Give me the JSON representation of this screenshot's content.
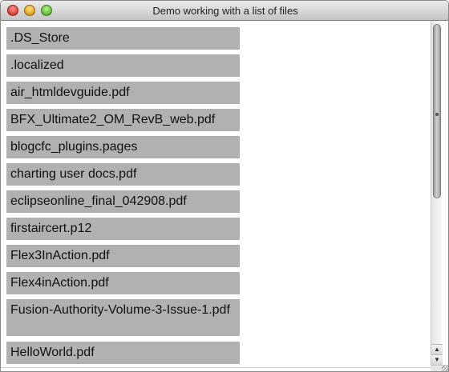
{
  "window": {
    "title": "Demo working with a list of files"
  },
  "files": [
    ".DS_Store",
    ".localized",
    "air_htmldevguide.pdf",
    "BFX_Ultimate2_OM_RevB_web.pdf",
    "blogcfc_plugins.pages",
    "charting user docs.pdf",
    "eclipseonline_final_042908.pdf",
    "firstaircert.p12",
    "Flex3InAction.pdf",
    "Flex4inAction.pdf",
    "Fusion-Authority-Volume-3-Issue-1.pdf",
    "HelloWorld.pdf"
  ],
  "colors": {
    "item_background": "#b1b1b1",
    "window_background": "#ffffff"
  }
}
